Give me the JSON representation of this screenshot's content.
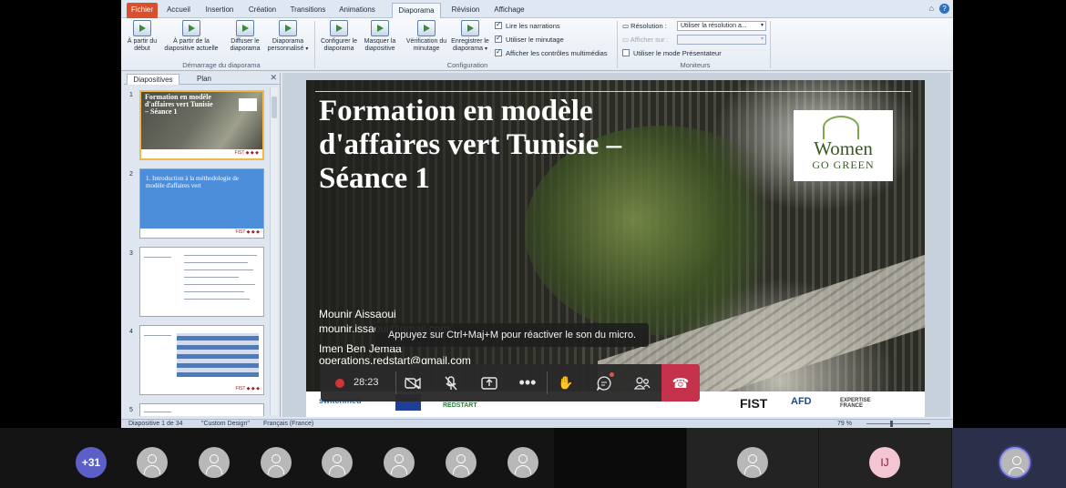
{
  "ribbon": {
    "tabs": [
      "Fichier",
      "Accueil",
      "Insertion",
      "Création",
      "Transitions",
      "Animations",
      "Diaporama",
      "Révision",
      "Affichage"
    ],
    "active_tab": "Diaporama",
    "start_group": {
      "label": "Démarrage du diaporama",
      "buttons": [
        "À partir du début",
        "À partir de la diapositive actuelle",
        "Diffuser le diaporama",
        "Diaporama personnalisé"
      ]
    },
    "config_group": {
      "label": "Configuration",
      "buttons": [
        "Configurer le diaporama",
        "Masquer la diapositive",
        "Vérification du minutage",
        "Enregistrer le diaporama"
      ],
      "checks": [
        {
          "label": "Lire les narrations",
          "checked": true
        },
        {
          "label": "Utiliser le minutage",
          "checked": true
        },
        {
          "label": "Afficher les contrôles multimédias",
          "checked": true
        }
      ]
    },
    "monitors_group": {
      "label": "Moniteurs",
      "resolution_label": "Résolution :",
      "resolution_value": "Utiliser la résolution a...",
      "show_on_label": "Afficher sur :",
      "presenter_mode_label": "Utiliser le mode Présentateur",
      "presenter_mode_checked": false
    }
  },
  "left_pane": {
    "tabs": [
      "Diapositives",
      "Plan"
    ],
    "active_tab": "Diapositives",
    "close": "✕",
    "thumbnails": [
      {
        "num": "1",
        "title": "Formation en modèle d'affaires vert Tunisie – Séance 1"
      },
      {
        "num": "2",
        "title": "1. Introduction à la méthodologie de modèle d'affaires vert"
      },
      {
        "num": "3",
        "title": ""
      },
      {
        "num": "4",
        "title": ""
      },
      {
        "num": "5",
        "title": ""
      }
    ]
  },
  "slide": {
    "title": "Formation en modèle d'affaires vert Tunisie – Séance 1",
    "logo_line1": "Women",
    "logo_line2": "GO GREEN",
    "author1_name": "Mounir Aissaoui",
    "author1_email": "mounir.issaoui@gmail.com",
    "author2_name": "Imen Ben Jemaa",
    "author2_email": "operations.redstart@gmail.com",
    "footer_logos": [
      "switchmed",
      "REDSTART",
      "FIST",
      "AFD",
      "EXPERTISE FRANCE"
    ]
  },
  "status_bar": {
    "slide_info": "Diapositive 1 de 34",
    "theme": "\"Custom Design\"",
    "language": "Français (France)",
    "zoom": "79 %"
  },
  "teams": {
    "tooltip": "Appuyez sur Ctrl+Maj+M pour réactiver le son du micro.",
    "timer": "28:23",
    "more_participants": "+31",
    "initials": "IJ"
  },
  "colors": {
    "ribbon_file_tab": "#d9502c",
    "hangup": "#c4314b",
    "record": "#d13438",
    "more_badge": "#5b5fc7"
  }
}
